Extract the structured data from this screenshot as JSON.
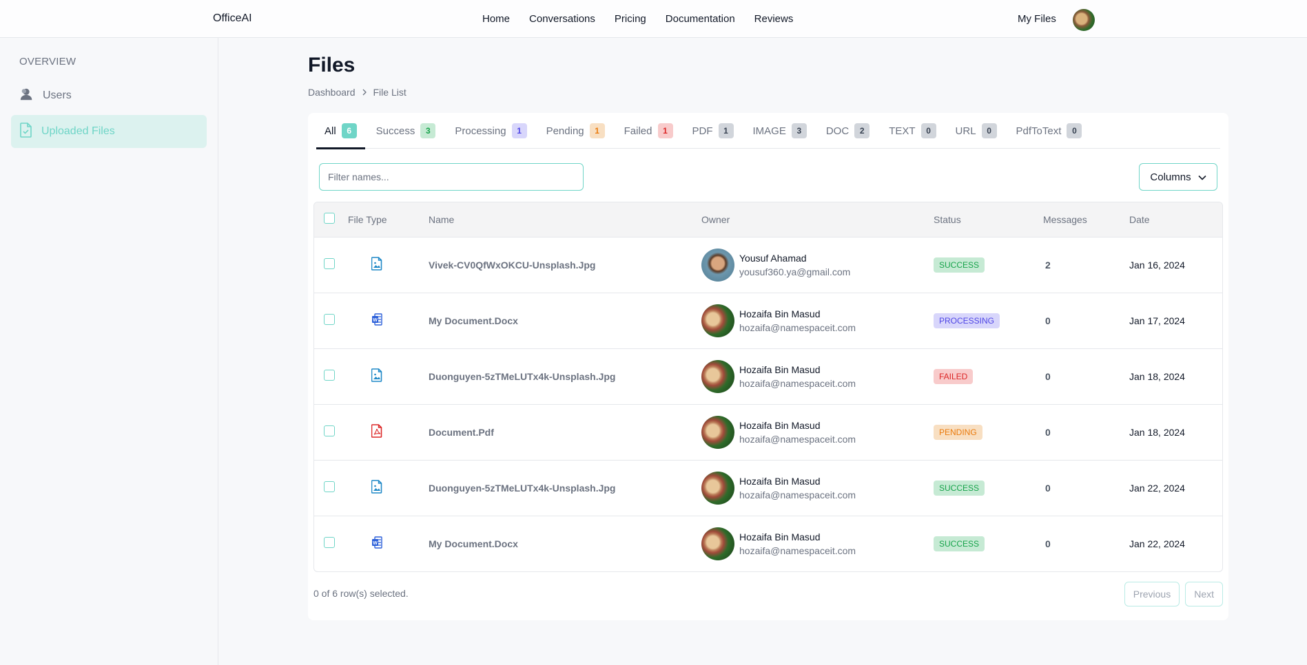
{
  "app": {
    "brand": "OfficeAI"
  },
  "nav": {
    "items": [
      "Home",
      "Conversations",
      "Pricing",
      "Documentation",
      "Reviews"
    ],
    "my_files": "My Files"
  },
  "sidebar": {
    "heading": "OVERVIEW",
    "items": [
      {
        "label": "Users",
        "icon": "user-icon",
        "active": false
      },
      {
        "label": "Uploaded Files",
        "icon": "file-check-icon",
        "active": true
      }
    ]
  },
  "page": {
    "title": "Files",
    "breadcrumb": [
      "Dashboard",
      "File List"
    ]
  },
  "tabs": [
    {
      "label": "All",
      "count": "6",
      "active": true,
      "badge_bg": "#6fd5c7",
      "badge_fg": "#ffffff"
    },
    {
      "label": "Success",
      "count": "3",
      "badge_bg": "#c6ead4",
      "badge_fg": "#16a34a"
    },
    {
      "label": "Processing",
      "count": "1",
      "badge_bg": "#d8d6fb",
      "badge_fg": "#4f46e5"
    },
    {
      "label": "Pending",
      "count": "1",
      "badge_bg": "#f8dfc2",
      "badge_fg": "#ea7a0c"
    },
    {
      "label": "Failed",
      "count": "1",
      "badge_bg": "#f8cbcb",
      "badge_fg": "#dc2626"
    },
    {
      "label": "PDF",
      "count": "1",
      "badge_bg": "#d1d5db",
      "badge_fg": "#374151"
    },
    {
      "label": "IMAGE",
      "count": "3",
      "badge_bg": "#d1d5db",
      "badge_fg": "#374151"
    },
    {
      "label": "DOC",
      "count": "2",
      "badge_bg": "#d1d5db",
      "badge_fg": "#374151"
    },
    {
      "label": "TEXT",
      "count": "0",
      "badge_bg": "#d1d5db",
      "badge_fg": "#374151"
    },
    {
      "label": "URL",
      "count": "0",
      "badge_bg": "#d1d5db",
      "badge_fg": "#374151"
    },
    {
      "label": "PdfToText",
      "count": "0",
      "badge_bg": "#d1d5db",
      "badge_fg": "#374151"
    }
  ],
  "filter": {
    "placeholder": "Filter names...",
    "value": ""
  },
  "columns_button": "Columns",
  "table": {
    "headers": [
      "File Type",
      "Name",
      "Owner",
      "Status",
      "Messages",
      "Date"
    ],
    "rows": [
      {
        "type": "image",
        "name": "Vivek-CV0QfWxOKCU-Unsplash.Jpg",
        "owner_name": "Yousuf Ahamad",
        "owner_email": "yousuf360.ya@gmail.com",
        "avatar": "man",
        "status": "SUCCESS",
        "messages": "2",
        "date": "Jan 16, 2024"
      },
      {
        "type": "doc",
        "name": "My Document.Docx",
        "owner_name": "Hozaifa Bin Masud",
        "owner_email": "hozaifa@namespaceit.com",
        "avatar": "kid",
        "status": "PROCESSING",
        "messages": "0",
        "date": "Jan 17, 2024"
      },
      {
        "type": "image",
        "name": "Duonguyen-5zTMeLUTx4k-Unsplash.Jpg",
        "owner_name": "Hozaifa Bin Masud",
        "owner_email": "hozaifa@namespaceit.com",
        "avatar": "kid",
        "status": "FAILED",
        "messages": "0",
        "date": "Jan 18, 2024"
      },
      {
        "type": "pdf",
        "name": "Document.Pdf",
        "owner_name": "Hozaifa Bin Masud",
        "owner_email": "hozaifa@namespaceit.com",
        "avatar": "kid",
        "status": "PENDING",
        "messages": "0",
        "date": "Jan 18, 2024"
      },
      {
        "type": "image",
        "name": "Duonguyen-5zTMeLUTx4k-Unsplash.Jpg",
        "owner_name": "Hozaifa Bin Masud",
        "owner_email": "hozaifa@namespaceit.com",
        "avatar": "kid",
        "status": "SUCCESS",
        "messages": "0",
        "date": "Jan 22, 2024"
      },
      {
        "type": "doc",
        "name": "My Document.Docx",
        "owner_name": "Hozaifa Bin Masud",
        "owner_email": "hozaifa@namespaceit.com",
        "avatar": "kid",
        "status": "SUCCESS",
        "messages": "0",
        "date": "Jan 22, 2024"
      }
    ]
  },
  "status_colors": {
    "SUCCESS": {
      "bg": "#c6ead4",
      "fg": "#16a34a"
    },
    "PROCESSING": {
      "bg": "#d8d6fb",
      "fg": "#4f46e5"
    },
    "FAILED": {
      "bg": "#f8cbcb",
      "fg": "#dc2626"
    },
    "PENDING": {
      "bg": "#f8dfc2",
      "fg": "#ea7a0c"
    }
  },
  "filetype_colors": {
    "image": "#1e88c7",
    "doc": "#2b5fd9",
    "pdf": "#dc2626"
  },
  "footer": {
    "selection": "0 of 6 row(s) selected.",
    "previous": "Previous",
    "next": "Next"
  }
}
